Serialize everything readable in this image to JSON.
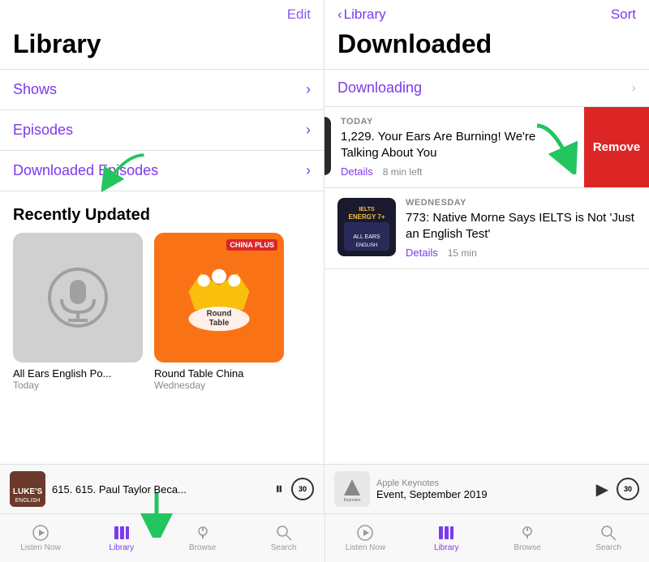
{
  "left": {
    "header": {
      "edit_label": "Edit"
    },
    "title": "Library",
    "nav_items": [
      {
        "id": "shows",
        "label": "Shows"
      },
      {
        "id": "episodes",
        "label": "Episodes"
      },
      {
        "id": "downloaded-episodes",
        "label": "Downloaded Episodes"
      }
    ],
    "recently_updated_title": "Recently Updated",
    "podcasts": [
      {
        "id": "all-ears-english",
        "name": "All Ears English Po...",
        "date": "Today",
        "type": "gray"
      },
      {
        "id": "round-table-china",
        "name": "Round Table China",
        "date": "Wednesday",
        "type": "orange",
        "badge": "CHINA PLUS"
      }
    ],
    "player": {
      "title": "615. 615. Paul Taylor Beca...",
      "pause_label": "⏸",
      "skip_label": "30"
    }
  },
  "right": {
    "header": {
      "back_label": "Library",
      "sort_label": "Sort"
    },
    "title": "Downloaded",
    "downloading_label": "Downloading",
    "episodes": [
      {
        "id": "ep1",
        "day": "TODAY",
        "title": "1,229. Your Ears Are Burning! We're Talking About You",
        "details_label": "Details",
        "duration": "8 min left",
        "swiped": true
      },
      {
        "id": "ep2",
        "day": "WEDNESDAY",
        "title": "773: Native Morne Says IELTS is Not 'Just an English Test'",
        "details_label": "Details",
        "duration": "15 min",
        "swiped": false
      }
    ],
    "remove_label": "Remove",
    "player": {
      "source": "Apple Keynotes",
      "title": "Event, September 2019",
      "play_label": "▶",
      "skip_label": "30"
    }
  },
  "tab_bar": {
    "left_tabs": [
      {
        "id": "listen-now",
        "label": "Listen Now",
        "icon": "▶"
      },
      {
        "id": "library",
        "label": "Library",
        "icon": "📚",
        "active": true
      },
      {
        "id": "browse",
        "label": "Browse",
        "icon": "🎙"
      },
      {
        "id": "search",
        "label": "Search",
        "icon": "🔍"
      }
    ],
    "right_tabs": [
      {
        "id": "listen-now-r",
        "label": "Listen Now",
        "icon": "▶"
      },
      {
        "id": "library-r",
        "label": "Library",
        "icon": "📚",
        "active": true
      },
      {
        "id": "browse-r",
        "label": "Browse",
        "icon": "🎙"
      },
      {
        "id": "search-r",
        "label": "Search",
        "icon": "🔍"
      }
    ]
  }
}
